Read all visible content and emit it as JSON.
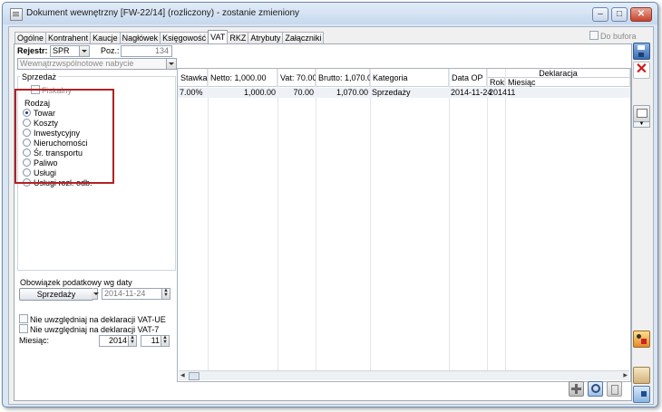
{
  "window": {
    "title": "Dokument wewnętrzny [FW-22/14] (rozliczony) - zostanie zmieniony"
  },
  "tabs": [
    {
      "label": "Ogólne"
    },
    {
      "label": "Kontrahent"
    },
    {
      "label": "Kaucje"
    },
    {
      "label": "Nagłówek"
    },
    {
      "label": "Księgowość"
    },
    {
      "label": "VAT",
      "active": true
    },
    {
      "label": "RKZ"
    },
    {
      "label": "Atrybuty"
    },
    {
      "label": "Załączniki"
    }
  ],
  "bufor": {
    "label": "Do bufora",
    "checked": false
  },
  "rejestr": {
    "label": "Rejestr:",
    "value": "SPR",
    "poz_label": "Poz.:",
    "poz_value": "134"
  },
  "rejestr_desc": "Wewnątrzwspólnotowe nabycie",
  "sprzedaz": {
    "title": "Sprzedaż",
    "fiskalny_label": "Fiskalny",
    "rodzaj_title": "Rodzaj",
    "options": [
      {
        "label": "Towar",
        "selected": true
      },
      {
        "label": "Koszty",
        "selected": false
      },
      {
        "label": "Inwestycyjny",
        "selected": false
      },
      {
        "label": "Nieruchomości",
        "selected": false
      },
      {
        "label": "Śr. transportu",
        "selected": false
      },
      {
        "label": "Paliwo",
        "selected": false
      },
      {
        "label": "Usługi",
        "selected": false
      },
      {
        "label": "Usługi rozl. odb.",
        "selected": false
      }
    ]
  },
  "obowiazek": {
    "title": "Obowiązek podatkowy wg daty",
    "button": "Sprzedaży",
    "date": "2014-11-24"
  },
  "flags": {
    "vat_ue": "Nie uwzględniaj na deklaracji VAT-UE",
    "vat7": "Nie uwzględniaj na deklaracji VAT-7"
  },
  "miesiac": {
    "label": "Miesiąc:",
    "year": "2014",
    "month": "11"
  },
  "grid": {
    "headers": {
      "stawka": "Stawka",
      "netto": "Netto: 1,000.00",
      "vat": "Vat: 70.00",
      "brutto": "Brutto: 1,070.00",
      "kategoria": "Kategoria",
      "data_op": "Data OP",
      "deklaracja": "Deklaracja",
      "rok": "Rok",
      "miesiac": "Miesiąc"
    },
    "rows": [
      {
        "stawka": "7.00%",
        "netto": "1,000.00",
        "vat": "70.00",
        "brutto": "1,070.00",
        "kategoria": "Sprzedaży",
        "data_op": "2014-11-24",
        "rok": "2014",
        "miesiac": "11"
      }
    ]
  },
  "colors": {
    "highlight_box": "#b22222",
    "accent": "#3a6fb5"
  }
}
